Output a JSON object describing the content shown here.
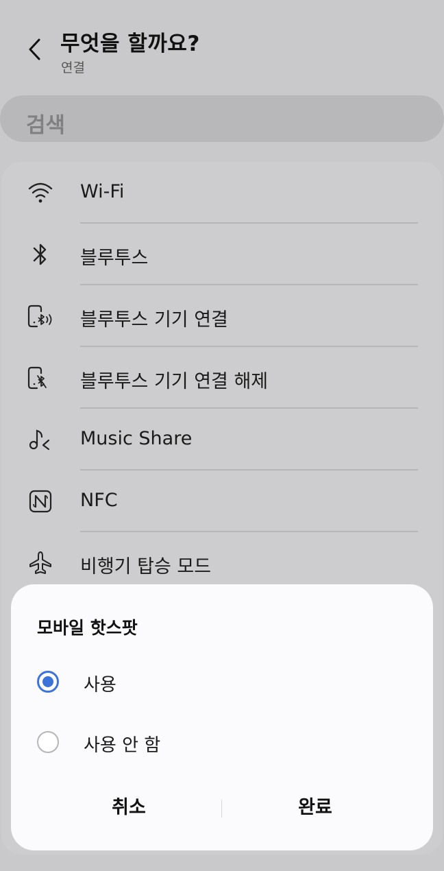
{
  "header": {
    "title": "무엇을 할까요?",
    "subtitle": "연결",
    "back_icon": "chevron-left-icon"
  },
  "search": {
    "placeholder": "검색"
  },
  "list": {
    "items": [
      {
        "label": "Wi-Fi",
        "icon": "wifi-icon"
      },
      {
        "label": "블루투스",
        "icon": "bluetooth-icon"
      },
      {
        "label": "블루투스 기기 연결",
        "icon": "bluetooth-device-connect-icon"
      },
      {
        "label": "블루투스 기기 연결 해제",
        "icon": "bluetooth-device-disconnect-icon"
      },
      {
        "label": "Music Share",
        "icon": "music-share-icon"
      },
      {
        "label": "NFC",
        "icon": "nfc-icon"
      },
      {
        "label": "비행기 탑승 모드",
        "icon": "airplane-icon"
      }
    ]
  },
  "dialog": {
    "title": "모바일 핫스팟",
    "options": [
      {
        "label": "사용",
        "selected": true
      },
      {
        "label": "사용 안 함",
        "selected": false
      }
    ],
    "cancel_label": "취소",
    "done_label": "완료"
  },
  "colors": {
    "accent": "#3c73d9",
    "background": "#c9c9cb",
    "dialog": "#fbfbfd"
  }
}
